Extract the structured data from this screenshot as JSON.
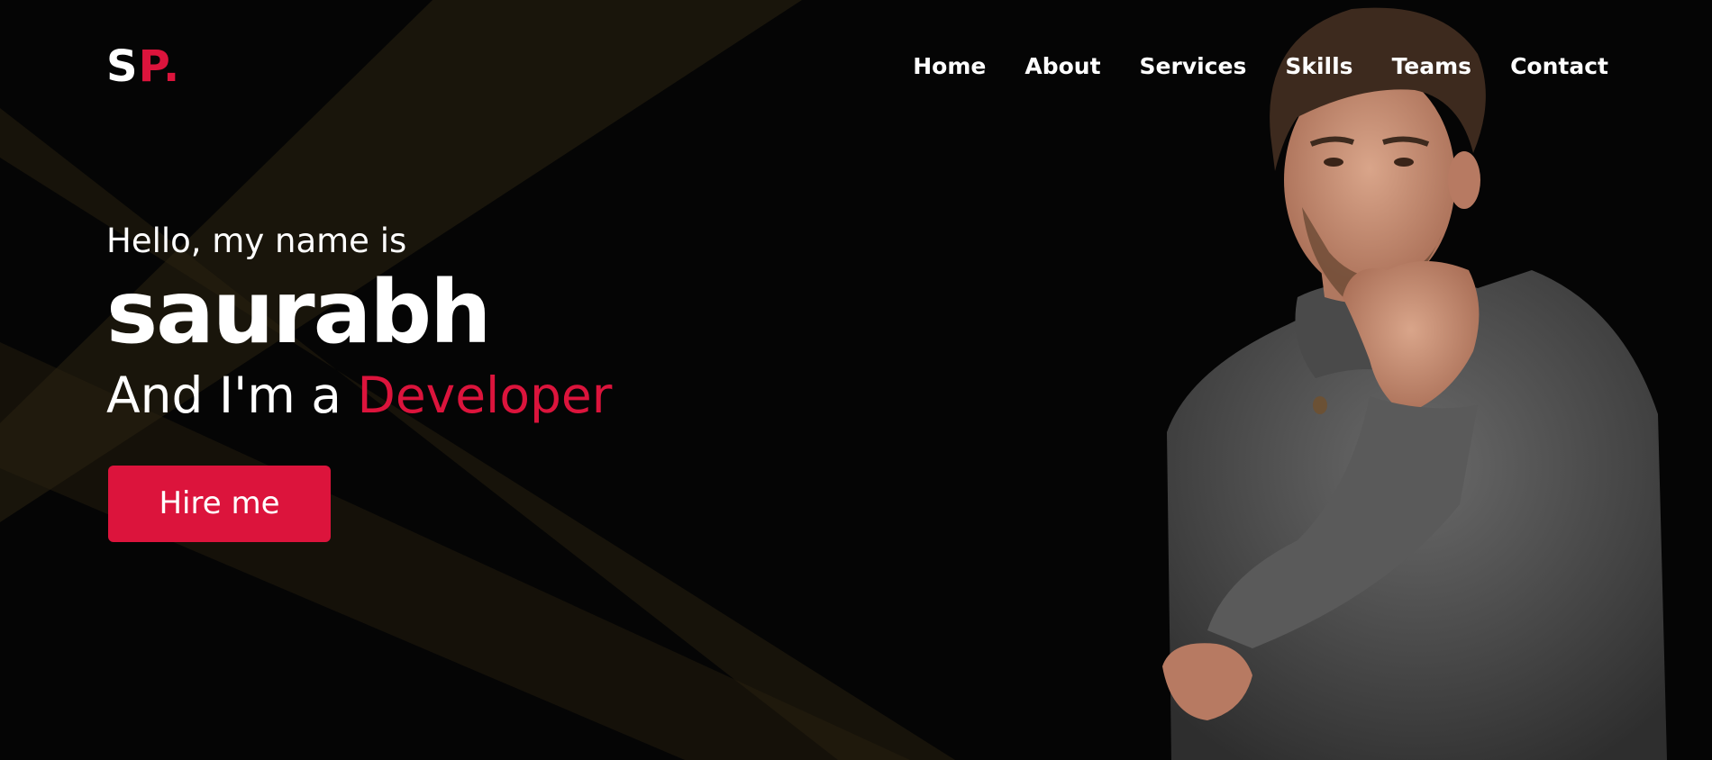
{
  "logo": {
    "part1": "S",
    "part2": "P."
  },
  "nav": {
    "items": [
      {
        "label": "Home"
      },
      {
        "label": "About"
      },
      {
        "label": "Services"
      },
      {
        "label": "Skills"
      },
      {
        "label": "Teams"
      },
      {
        "label": "Contact"
      }
    ]
  },
  "hero": {
    "greeting": "Hello, my name is",
    "name": "saurabh",
    "role_prefix": "And I'm a",
    "role": "Developer",
    "cta_label": "Hire me"
  },
  "colors": {
    "background": "#050505",
    "accent": "#dc143c",
    "text": "#ffffff"
  }
}
